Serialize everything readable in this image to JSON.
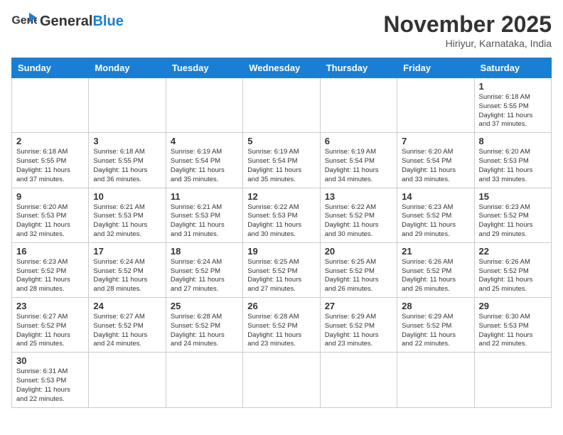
{
  "header": {
    "logo_general": "General",
    "logo_blue": "Blue",
    "month_title": "November 2025",
    "location": "Hiriyur, Karnataka, India"
  },
  "weekdays": [
    "Sunday",
    "Monday",
    "Tuesday",
    "Wednesday",
    "Thursday",
    "Friday",
    "Saturday"
  ],
  "weeks": [
    [
      {
        "day": "",
        "info": ""
      },
      {
        "day": "",
        "info": ""
      },
      {
        "day": "",
        "info": ""
      },
      {
        "day": "",
        "info": ""
      },
      {
        "day": "",
        "info": ""
      },
      {
        "day": "",
        "info": ""
      },
      {
        "day": "1",
        "info": "Sunrise: 6:18 AM\nSunset: 5:55 PM\nDaylight: 11 hours\nand 37 minutes."
      }
    ],
    [
      {
        "day": "2",
        "info": "Sunrise: 6:18 AM\nSunset: 5:55 PM\nDaylight: 11 hours\nand 37 minutes."
      },
      {
        "day": "3",
        "info": "Sunrise: 6:18 AM\nSunset: 5:55 PM\nDaylight: 11 hours\nand 36 minutes."
      },
      {
        "day": "4",
        "info": "Sunrise: 6:19 AM\nSunset: 5:54 PM\nDaylight: 11 hours\nand 35 minutes."
      },
      {
        "day": "5",
        "info": "Sunrise: 6:19 AM\nSunset: 5:54 PM\nDaylight: 11 hours\nand 35 minutes."
      },
      {
        "day": "6",
        "info": "Sunrise: 6:19 AM\nSunset: 5:54 PM\nDaylight: 11 hours\nand 34 minutes."
      },
      {
        "day": "7",
        "info": "Sunrise: 6:20 AM\nSunset: 5:54 PM\nDaylight: 11 hours\nand 33 minutes."
      },
      {
        "day": "8",
        "info": "Sunrise: 6:20 AM\nSunset: 5:53 PM\nDaylight: 11 hours\nand 33 minutes."
      }
    ],
    [
      {
        "day": "9",
        "info": "Sunrise: 6:20 AM\nSunset: 5:53 PM\nDaylight: 11 hours\nand 32 minutes."
      },
      {
        "day": "10",
        "info": "Sunrise: 6:21 AM\nSunset: 5:53 PM\nDaylight: 11 hours\nand 32 minutes."
      },
      {
        "day": "11",
        "info": "Sunrise: 6:21 AM\nSunset: 5:53 PM\nDaylight: 11 hours\nand 31 minutes."
      },
      {
        "day": "12",
        "info": "Sunrise: 6:22 AM\nSunset: 5:53 PM\nDaylight: 11 hours\nand 30 minutes."
      },
      {
        "day": "13",
        "info": "Sunrise: 6:22 AM\nSunset: 5:52 PM\nDaylight: 11 hours\nand 30 minutes."
      },
      {
        "day": "14",
        "info": "Sunrise: 6:23 AM\nSunset: 5:52 PM\nDaylight: 11 hours\nand 29 minutes."
      },
      {
        "day": "15",
        "info": "Sunrise: 6:23 AM\nSunset: 5:52 PM\nDaylight: 11 hours\nand 29 minutes."
      }
    ],
    [
      {
        "day": "16",
        "info": "Sunrise: 6:23 AM\nSunset: 5:52 PM\nDaylight: 11 hours\nand 28 minutes."
      },
      {
        "day": "17",
        "info": "Sunrise: 6:24 AM\nSunset: 5:52 PM\nDaylight: 11 hours\nand 28 minutes."
      },
      {
        "day": "18",
        "info": "Sunrise: 6:24 AM\nSunset: 5:52 PM\nDaylight: 11 hours\nand 27 minutes."
      },
      {
        "day": "19",
        "info": "Sunrise: 6:25 AM\nSunset: 5:52 PM\nDaylight: 11 hours\nand 27 minutes."
      },
      {
        "day": "20",
        "info": "Sunrise: 6:25 AM\nSunset: 5:52 PM\nDaylight: 11 hours\nand 26 minutes."
      },
      {
        "day": "21",
        "info": "Sunrise: 6:26 AM\nSunset: 5:52 PM\nDaylight: 11 hours\nand 26 minutes."
      },
      {
        "day": "22",
        "info": "Sunrise: 6:26 AM\nSunset: 5:52 PM\nDaylight: 11 hours\nand 25 minutes."
      }
    ],
    [
      {
        "day": "23",
        "info": "Sunrise: 6:27 AM\nSunset: 5:52 PM\nDaylight: 11 hours\nand 25 minutes."
      },
      {
        "day": "24",
        "info": "Sunrise: 6:27 AM\nSunset: 5:52 PM\nDaylight: 11 hours\nand 24 minutes."
      },
      {
        "day": "25",
        "info": "Sunrise: 6:28 AM\nSunset: 5:52 PM\nDaylight: 11 hours\nand 24 minutes."
      },
      {
        "day": "26",
        "info": "Sunrise: 6:28 AM\nSunset: 5:52 PM\nDaylight: 11 hours\nand 23 minutes."
      },
      {
        "day": "27",
        "info": "Sunrise: 6:29 AM\nSunset: 5:52 PM\nDaylight: 11 hours\nand 23 minutes."
      },
      {
        "day": "28",
        "info": "Sunrise: 6:29 AM\nSunset: 5:52 PM\nDaylight: 11 hours\nand 22 minutes."
      },
      {
        "day": "29",
        "info": "Sunrise: 6:30 AM\nSunset: 5:53 PM\nDaylight: 11 hours\nand 22 minutes."
      }
    ],
    [
      {
        "day": "30",
        "info": "Sunrise: 6:31 AM\nSunset: 5:53 PM\nDaylight: 11 hours\nand 22 minutes."
      },
      {
        "day": "",
        "info": ""
      },
      {
        "day": "",
        "info": ""
      },
      {
        "day": "",
        "info": ""
      },
      {
        "day": "",
        "info": ""
      },
      {
        "day": "",
        "info": ""
      },
      {
        "day": "",
        "info": ""
      }
    ]
  ]
}
